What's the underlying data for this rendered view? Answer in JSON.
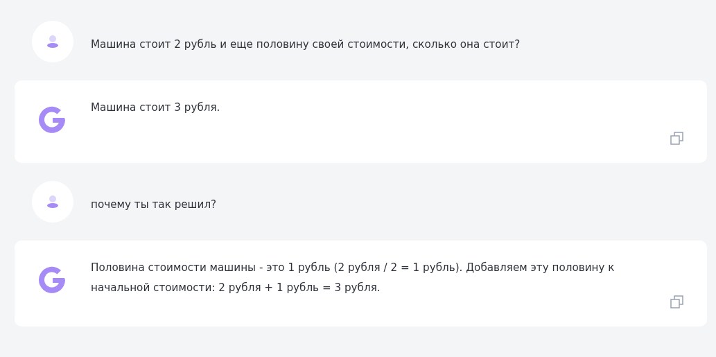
{
  "messages": [
    {
      "kind": "user",
      "text": "Машина стоит 2 рубль и еще половину своей стоимости, сколько она стоит?"
    },
    {
      "kind": "bot",
      "text": "Машина стоит 3 рубля."
    },
    {
      "kind": "user",
      "text": "почему ты так решил?"
    },
    {
      "kind": "bot",
      "text": "Половина стоимости машины - это 1 рубль (2 рубля / 2 = 1 рубль). Добавляем эту половину к начальной стоимости: 2 рубля + 1 рубль = 3 рубля."
    }
  ]
}
